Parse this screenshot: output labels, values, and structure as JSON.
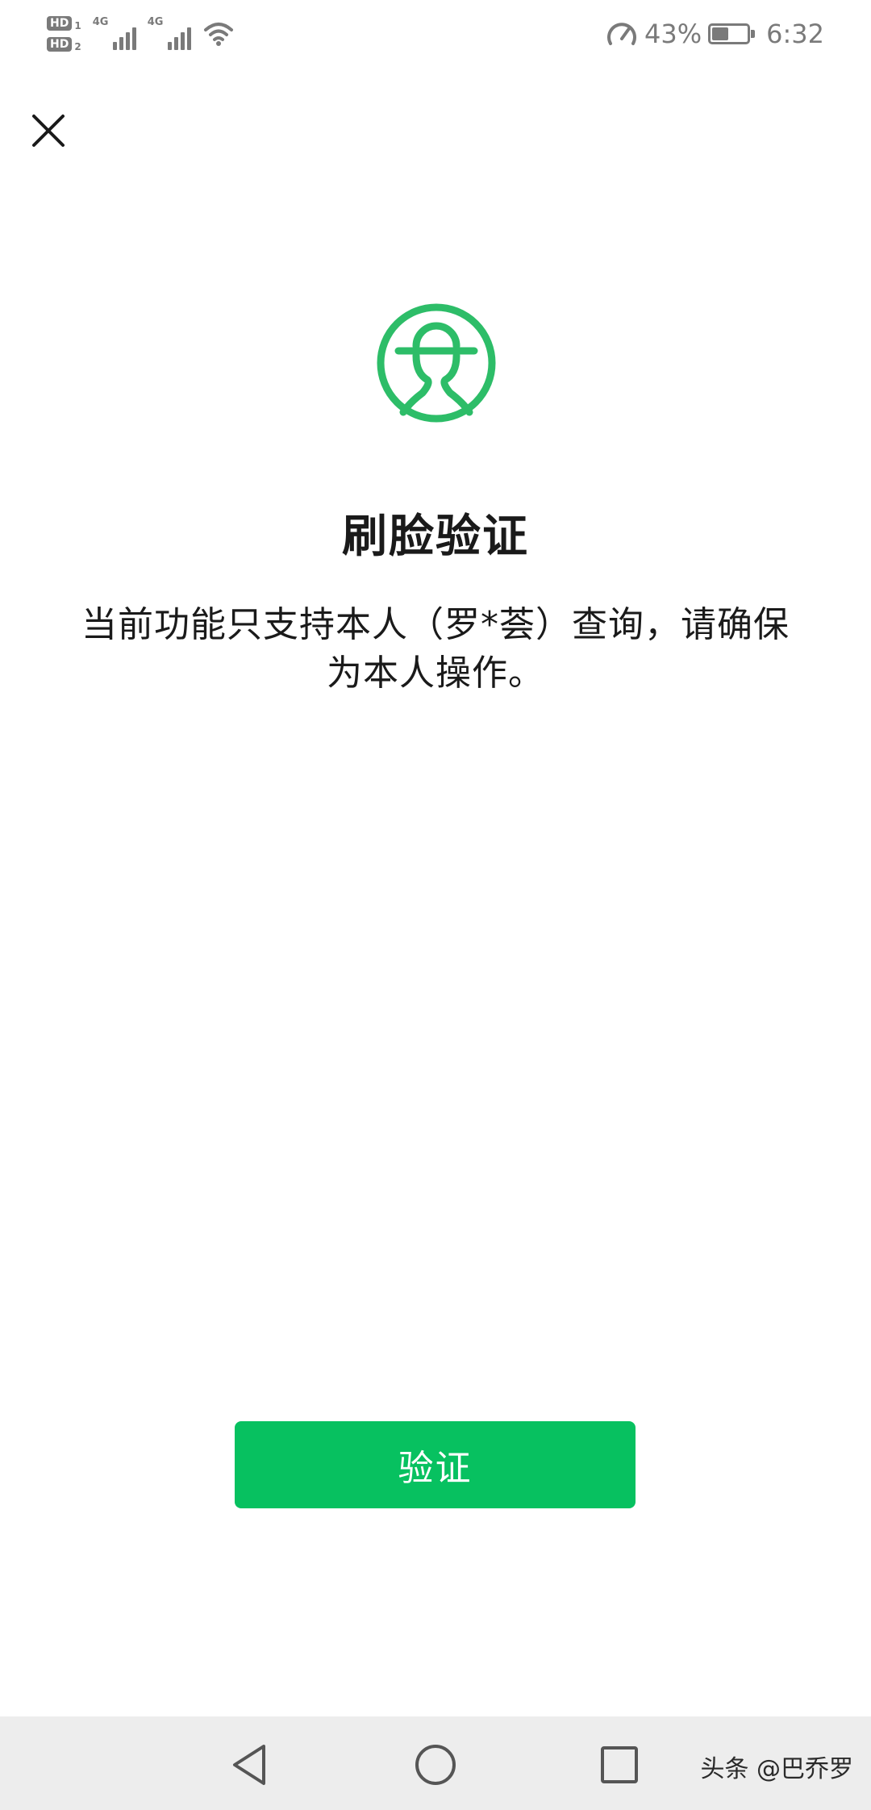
{
  "status_bar": {
    "hd1": "HD",
    "hd1_sub": "1",
    "hd2": "HD",
    "hd2_sub": "2",
    "net1": "4G",
    "net2": "4G",
    "battery_percent": "43%",
    "battery_level": 0.43,
    "time": "6:32",
    "icons": [
      "speed-icon",
      "wifi-icon",
      "signal-icon",
      "battery-icon"
    ]
  },
  "header": {
    "close_icon": "close-icon"
  },
  "main": {
    "icon": "face-verify-icon",
    "title": "刷脸验证",
    "description_line1": "当前功能只支持本人（罗*荟）查询，请确保",
    "description_line2": "为本人操作。",
    "verify_button": "验证"
  },
  "nav_bar": {
    "back_icon": "back-triangle-icon",
    "home_icon": "home-circle-icon",
    "recent_icon": "recent-square-icon",
    "watermark": "头条 @巴乔罗"
  },
  "colors": {
    "accent": "#07c160",
    "icon_green": "#2dbd68",
    "nav_bg": "#ededed",
    "status_gray": "#7a7a7a"
  }
}
